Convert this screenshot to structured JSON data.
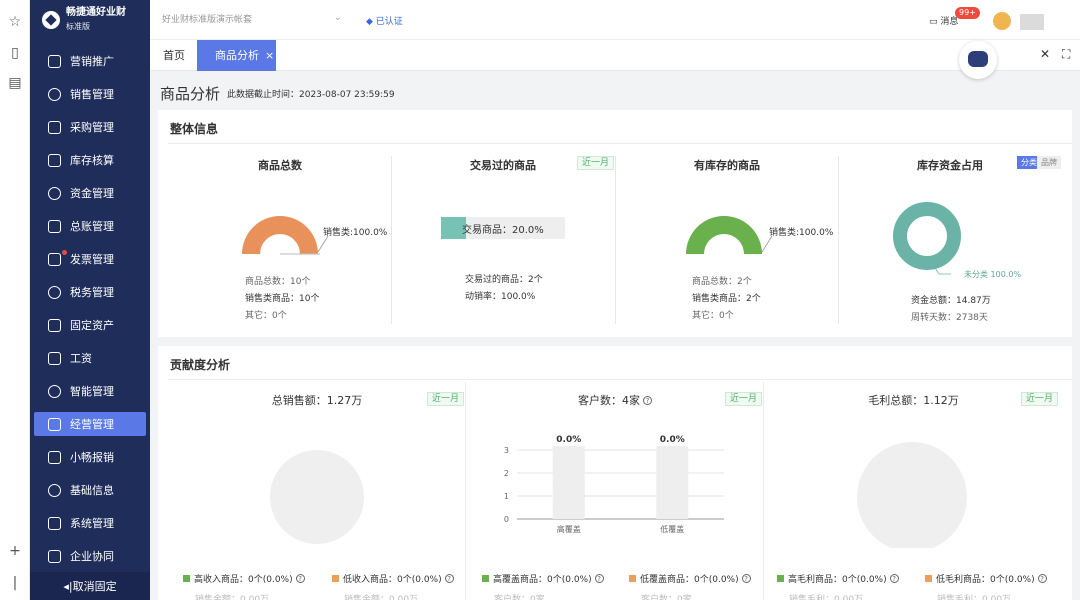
{
  "brand": {
    "name": "畅捷通好业财",
    "edition": "标准版"
  },
  "sidebar": {
    "items": [
      {
        "label": "营销推广",
        "icon": "store-icon"
      },
      {
        "label": "销售管理",
        "icon": "sales-icon"
      },
      {
        "label": "采购管理",
        "icon": "cart-icon"
      },
      {
        "label": "库存核算",
        "icon": "warehouse-icon"
      },
      {
        "label": "资金管理",
        "icon": "money-icon"
      },
      {
        "label": "总账管理",
        "icon": "ledger-icon"
      },
      {
        "label": "发票管理",
        "icon": "invoice-icon"
      },
      {
        "label": "税务管理",
        "icon": "tax-icon"
      },
      {
        "label": "固定资产",
        "icon": "asset-icon"
      },
      {
        "label": "工资",
        "icon": "salary-icon"
      },
      {
        "label": "智能管理",
        "icon": "smart-icon"
      },
      {
        "label": "经营管理",
        "icon": "business-icon"
      },
      {
        "label": "小畅报销",
        "icon": "reimburse-icon"
      },
      {
        "label": "基础信息",
        "icon": "info-icon"
      },
      {
        "label": "系统管理",
        "icon": "system-icon"
      },
      {
        "label": "企业协同",
        "icon": "collab-icon"
      }
    ],
    "active_index": 11,
    "unpin_label": "◂|取消固定"
  },
  "topbar": {
    "account": "好业财标准版演示帐套",
    "verified": "已认证",
    "messages_label": "消息",
    "messages_badge": "99+"
  },
  "tabs": [
    {
      "label": "首页",
      "active": false
    },
    {
      "label": "商品分析",
      "active": true,
      "close": "×"
    }
  ],
  "page": {
    "title": "商品分析",
    "data_cutoff": "此数据截止时间：2023-08-07 23:59:59"
  },
  "overview": {
    "title": "整体信息",
    "total_goods": {
      "heading": "商品总数",
      "donut_label": "销售类:100.0%",
      "lines": [
        "商品总数：10个",
        "销售类商品：10个",
        "其它：0个"
      ],
      "color": "#e8915a"
    },
    "traded_goods": {
      "heading": "交易过的商品",
      "tag": "近一月",
      "bar_label": "交易商品：20.0%",
      "bar_percent": 20.0,
      "lines": [
        "交易过的商品：2个",
        "动销率：100.0%"
      ],
      "color": "#76c2b5"
    },
    "stocked_goods": {
      "heading": "有库存的商品",
      "donut_label": "销售类:100.0%",
      "lines": [
        "商品总数：2个",
        "销售类商品：2个",
        "其它：0个"
      ],
      "color": "#6ab04c"
    },
    "inventory_capital": {
      "heading": "库存资金占用",
      "toggle": [
        "分类",
        "品牌"
      ],
      "donut_label": "未分类 100.0%",
      "lines": [
        "资金总额：14.87万",
        "周转天数：2738天"
      ],
      "color": "#6bb3a6"
    }
  },
  "contribution": {
    "title": "贡献度分析",
    "sales": {
      "heading": "总销售额：1.27万",
      "tag": "近一月",
      "legend": [
        "高收入商品：0个(0.0%)",
        "低收入商品：0个(0.0%)"
      ],
      "sub": [
        "销售金额：0.00万",
        "销售金额：0.00万"
      ]
    },
    "customers": {
      "heading": "客户数：4家",
      "tag": "近一月",
      "legend": [
        "高覆盖商品：0个(0.0%)",
        "低覆盖商品：0个(0.0%)"
      ],
      "sub": [
        "客户数：0家",
        "客户数：0家"
      ]
    },
    "gross_profit": {
      "heading": "毛利总额：1.12万",
      "tag": "近一月",
      "legend": [
        "高毛利商品：0个(0.0%)",
        "低毛利商品：0个(0.0%)"
      ],
      "sub": [
        "销售毛利：0.00万",
        "销售毛利：0.00万"
      ]
    },
    "legend_colors": {
      "high": "#6ab04c",
      "low": "#e8a05a"
    }
  },
  "chart_data": {
    "type": "bar",
    "categories": [
      "高覆盖",
      "低覆盖"
    ],
    "values": [
      0,
      0
    ],
    "data_labels": [
      "0.0%",
      "0.0%"
    ],
    "ylim": [
      0,
      3
    ],
    "yticks": [
      "0",
      "1",
      "2",
      "3"
    ],
    "grid": true
  }
}
